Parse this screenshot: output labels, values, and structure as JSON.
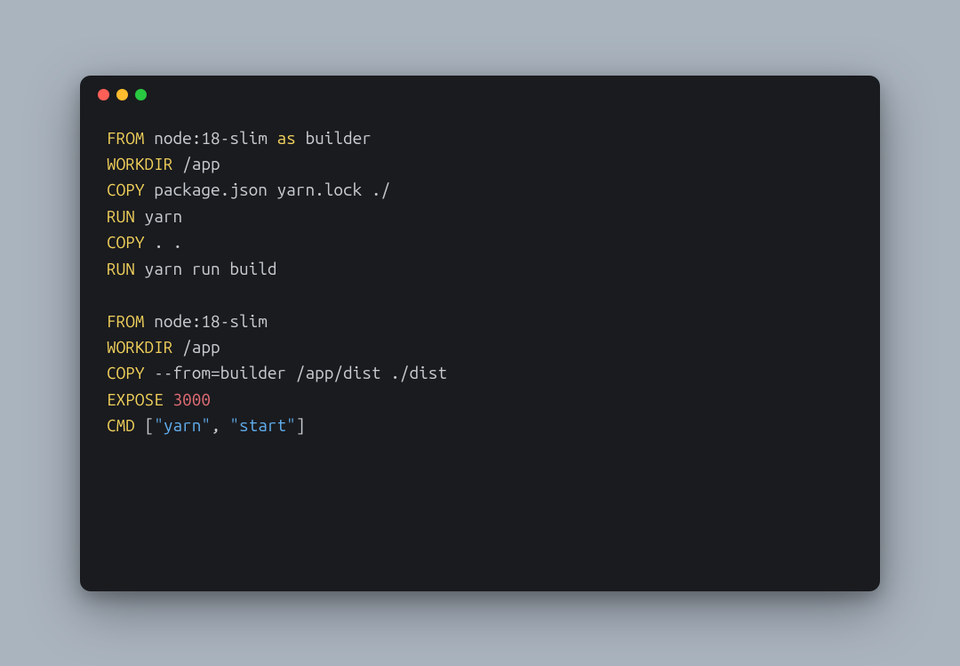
{
  "window": {
    "dots": [
      "red",
      "yellow",
      "green"
    ]
  },
  "code": {
    "lines": [
      [
        {
          "cls": "kw",
          "text": "FROM"
        },
        {
          "cls": "arg",
          "text": " node:18-slim "
        },
        {
          "cls": "kw",
          "text": "as"
        },
        {
          "cls": "arg",
          "text": " builder"
        }
      ],
      [
        {
          "cls": "kw",
          "text": "WORKDIR"
        },
        {
          "cls": "arg",
          "text": " /app"
        }
      ],
      [
        {
          "cls": "kw",
          "text": "COPY"
        },
        {
          "cls": "arg",
          "text": " package.json yarn.lock ./"
        }
      ],
      [
        {
          "cls": "kw",
          "text": "RUN"
        },
        {
          "cls": "arg",
          "text": " yarn"
        }
      ],
      [
        {
          "cls": "kw",
          "text": "COPY"
        },
        {
          "cls": "arg",
          "text": " . ."
        }
      ],
      [
        {
          "cls": "kw",
          "text": "RUN"
        },
        {
          "cls": "arg",
          "text": " yarn run build"
        }
      ],
      [
        {
          "cls": "arg",
          "text": ""
        }
      ],
      [
        {
          "cls": "kw",
          "text": "FROM"
        },
        {
          "cls": "arg",
          "text": " node:18-slim"
        }
      ],
      [
        {
          "cls": "kw",
          "text": "WORKDIR"
        },
        {
          "cls": "arg",
          "text": " /app"
        }
      ],
      [
        {
          "cls": "kw",
          "text": "COPY"
        },
        {
          "cls": "arg",
          "text": " --from=builder /app/dist ./dist"
        }
      ],
      [
        {
          "cls": "kw",
          "text": "EXPOSE"
        },
        {
          "cls": "arg",
          "text": " "
        },
        {
          "cls": "num",
          "text": "3000"
        }
      ],
      [
        {
          "cls": "kw",
          "text": "CMD"
        },
        {
          "cls": "arg",
          "text": " ["
        },
        {
          "cls": "str",
          "text": "\"yarn\""
        },
        {
          "cls": "arg",
          "text": ", "
        },
        {
          "cls": "str",
          "text": "\"start\""
        },
        {
          "cls": "arg",
          "text": "]"
        }
      ]
    ]
  }
}
